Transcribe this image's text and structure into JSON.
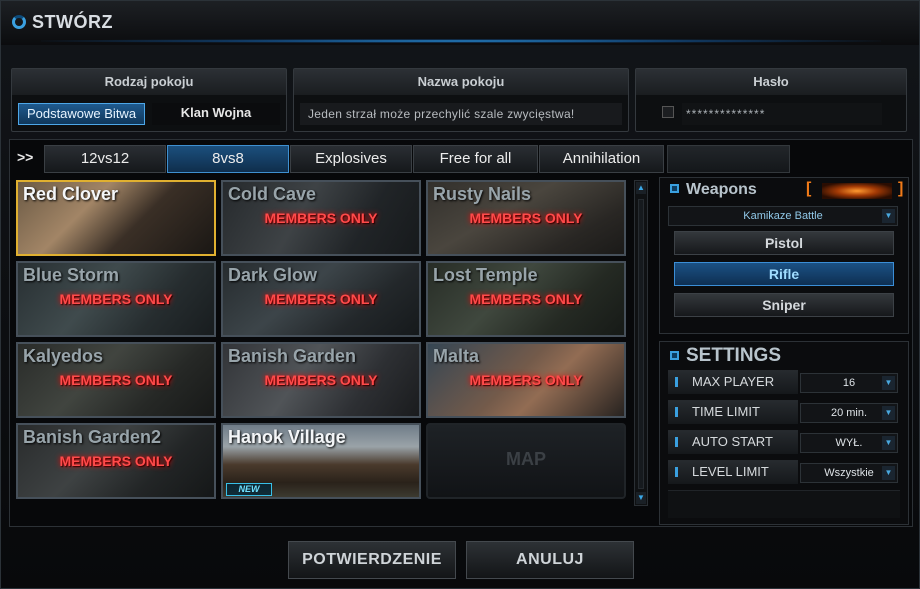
{
  "window": {
    "title": "STWÓRZ"
  },
  "room_type": {
    "header": "Rodzaj pokoju",
    "options": [
      {
        "label": "Podstawowe Bitwa",
        "active": true
      },
      {
        "label": "Klan Wojna",
        "active": false
      }
    ]
  },
  "room_name": {
    "header": "Nazwa pokoju",
    "value": "Jeden strzał może przechylić szale zwycięstwa!"
  },
  "password": {
    "header": "Hasło",
    "value": "**************"
  },
  "mode_tabs": {
    "arrow": ">>",
    "tabs": [
      {
        "label": "12vs12",
        "active": false
      },
      {
        "label": "8vs8",
        "active": true
      },
      {
        "label": "Explosives",
        "active": false
      },
      {
        "label": "Free for all",
        "active": false
      },
      {
        "label": "Annihilation",
        "active": false
      }
    ]
  },
  "maps": {
    "members_label": "MEMBERS ONLY",
    "new_label": "NEW",
    "empty_label": "MAP",
    "items": [
      {
        "name": "Red Clover",
        "locked": false,
        "selected": true,
        "new": false
      },
      {
        "name": "Cold Cave",
        "locked": true,
        "selected": false,
        "new": false
      },
      {
        "name": "Rusty Nails",
        "locked": true,
        "selected": false,
        "new": false
      },
      {
        "name": "Blue Storm",
        "locked": true,
        "selected": false,
        "new": false
      },
      {
        "name": "Dark Glow",
        "locked": true,
        "selected": false,
        "new": false
      },
      {
        "name": "Lost Temple",
        "locked": true,
        "selected": false,
        "new": false
      },
      {
        "name": "Kalyedos",
        "locked": true,
        "selected": false,
        "new": false
      },
      {
        "name": "Banish Garden",
        "locked": true,
        "selected": false,
        "new": false
      },
      {
        "name": "Malta",
        "locked": true,
        "selected": false,
        "new": false
      },
      {
        "name": "Banish Garden2",
        "locked": true,
        "selected": false,
        "new": false
      },
      {
        "name": "Hanok Village",
        "locked": false,
        "selected": false,
        "new": true
      }
    ]
  },
  "weapons": {
    "title": "Weapons",
    "mode_select": "Kamikaze Battle",
    "buttons": [
      {
        "label": "Pistol",
        "active": false
      },
      {
        "label": "Rifle",
        "active": true
      },
      {
        "label": "Sniper",
        "active": false
      }
    ]
  },
  "settings": {
    "title": "SETTINGS",
    "rows": [
      {
        "label": "MAX PLAYER",
        "value": "16"
      },
      {
        "label": "TIME LIMIT",
        "value": "20 min."
      },
      {
        "label": "AUTO START",
        "value": "WYŁ."
      },
      {
        "label": "LEVEL LIMIT",
        "value": "Wszystkie"
      }
    ]
  },
  "footer": {
    "confirm_label": "POTWIERDZENIE",
    "cancel_label": "ANULUJ"
  },
  "colors": {
    "accent": "#3aa0e0",
    "selected_border": "#e0b030",
    "members_red": "#ff4a4a"
  }
}
